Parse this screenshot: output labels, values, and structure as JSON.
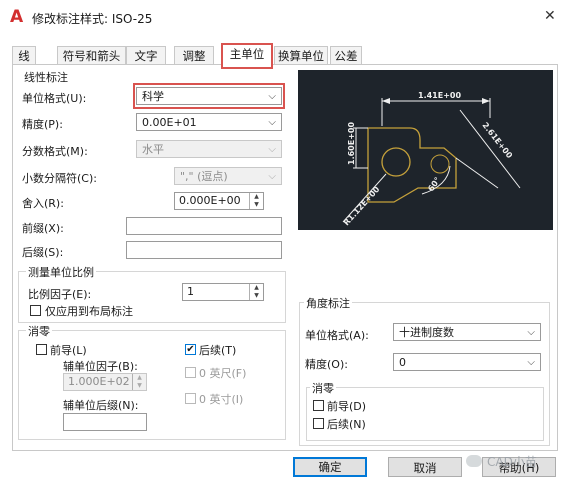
{
  "window": {
    "title": "修改标注样式: ISO-25",
    "close_glyph": "✕",
    "app_glyph": "A"
  },
  "tabs": [
    {
      "label": "线"
    },
    {
      "label": "符号和箭头"
    },
    {
      "label": "文字"
    },
    {
      "label": "调整"
    },
    {
      "label": "主单位",
      "active": true
    },
    {
      "label": "换算单位"
    },
    {
      "label": "公差"
    }
  ],
  "linear": {
    "title": "线性标注",
    "unit_format_label": "单位格式(U):",
    "unit_format_value": "科学",
    "precision_label": "精度(P):",
    "precision_value": "0.00E+01",
    "fraction_format_label": "分数格式(M):",
    "fraction_format_value": "水平",
    "decimal_sep_label": "小数分隔符(C):",
    "decimal_sep_value": "\",\" (逗点)",
    "roundoff_label": "舍入(R):",
    "roundoff_value": "0.000E+00",
    "prefix_label": "前缀(X):",
    "prefix_value": "",
    "suffix_label": "后缀(S):",
    "suffix_value": ""
  },
  "scale": {
    "title": "测量单位比例",
    "factor_label": "比例因子(E):",
    "factor_value": "1",
    "layout_only_label": "仅应用到布局标注"
  },
  "zero_linear": {
    "title": "消零",
    "leading_label": "前导(L)",
    "trailing_label": "后续(T)",
    "sub_factor_label": "辅单位因子(B):",
    "sub_factor_value": "1.000E+02",
    "sub_suffix_label": "辅单位后缀(N):",
    "sub_suffix_value": "",
    "feet_label": "0 英尺(F)",
    "inches_label": "0 英寸(I)",
    "check_mark": "✔"
  },
  "angular": {
    "title": "角度标注",
    "unit_format_label": "单位格式(A):",
    "unit_format_value": "十进制度数",
    "precision_label": "精度(O):",
    "precision_value": "0"
  },
  "zero_angular": {
    "title": "消零",
    "leading_label": "前导(D)",
    "trailing_label": "后续(N)"
  },
  "preview": {
    "dim_top": "1.41E+00",
    "dim_left": "1.60E+00",
    "dim_right": "2.61E+00",
    "dim_radius": "R1.12E+00",
    "dim_angle": "60°",
    "bg_color": "#1e242b",
    "line_color": "#f0f0f0",
    "shape_color": "#c5a13b"
  },
  "buttons": {
    "ok": "确定",
    "cancel": "取消",
    "help": "帮助(H)"
  },
  "watermark": "CAD小苗",
  "colors": {
    "highlight": "#d9534f",
    "accent": "#0078d7",
    "title_icon": "#d32f2f"
  }
}
